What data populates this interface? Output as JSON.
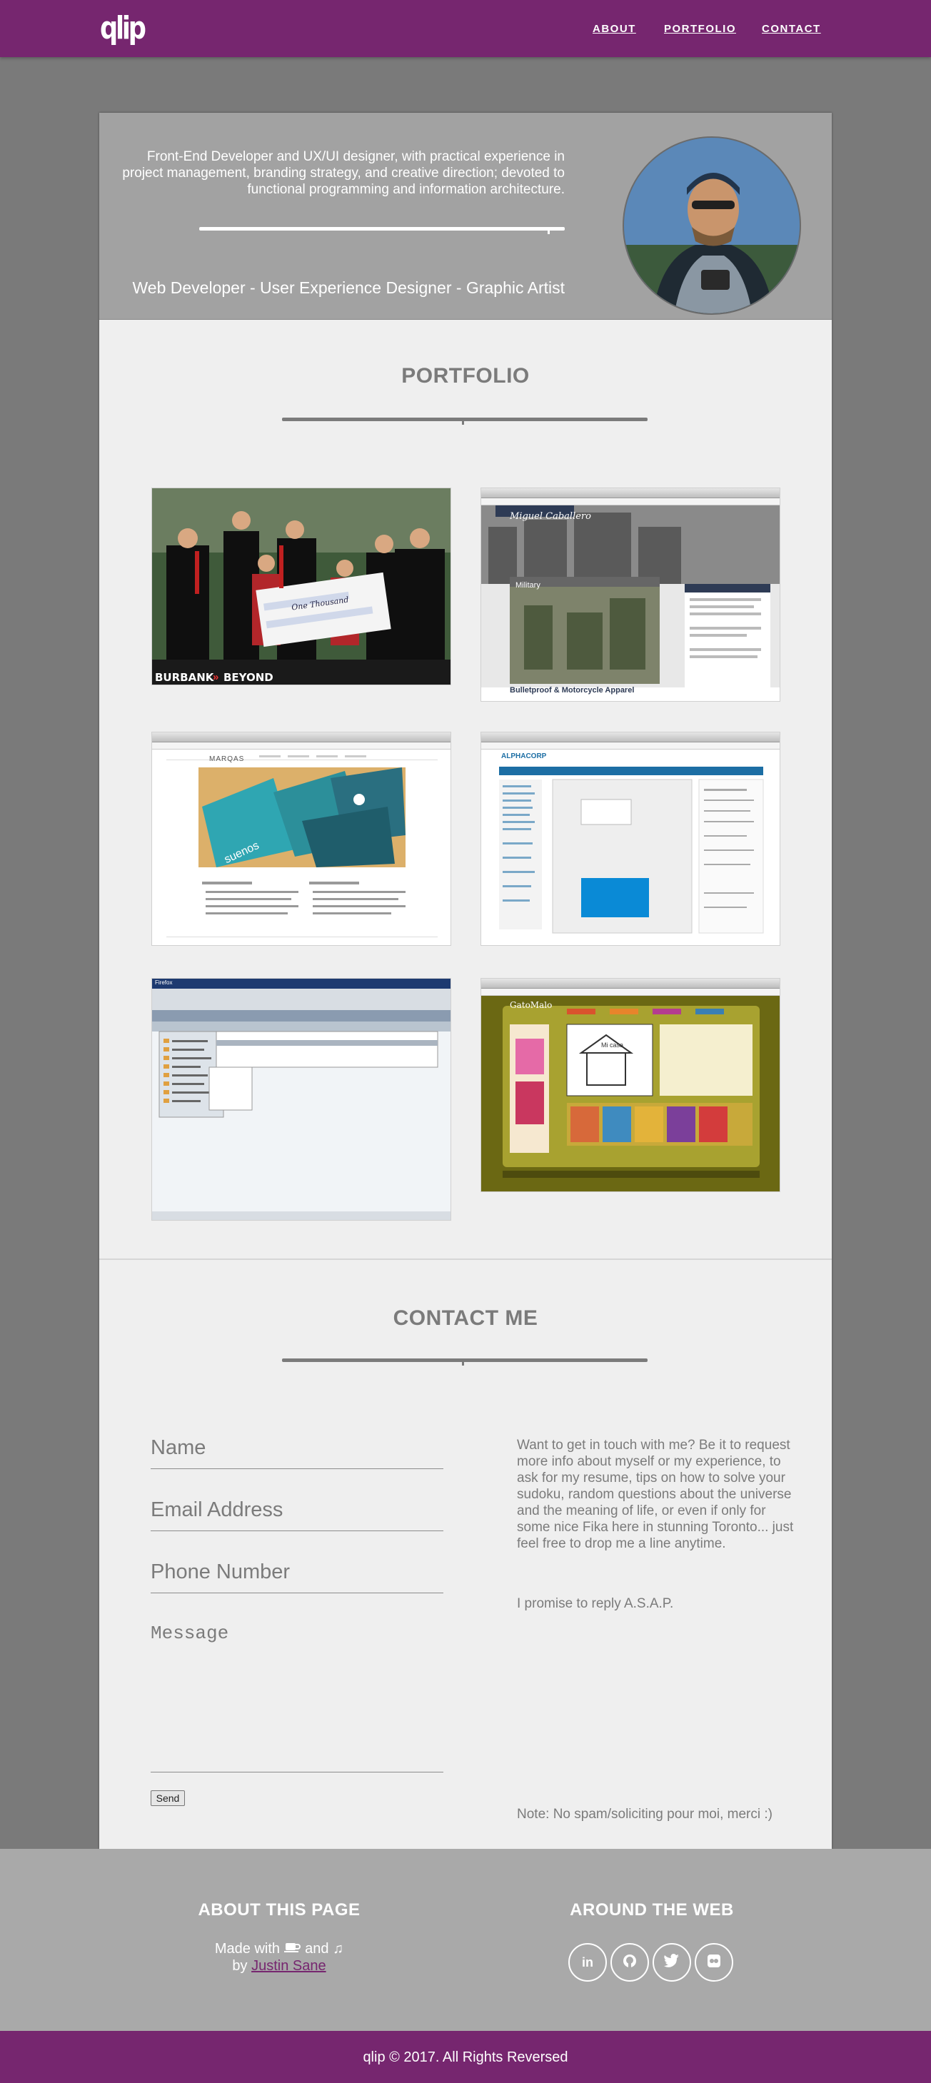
{
  "nav": {
    "logo": "qlip",
    "links": [
      {
        "label": "ABOUT"
      },
      {
        "label": "PORTFOLIO"
      },
      {
        "label": "CONTACT"
      }
    ]
  },
  "hero": {
    "description": "Front-End Developer and UX/UI designer, with practical experience in project management, branding strategy, and creative direction; devoted to functional programming and information architecture.",
    "roles": "Web Developer - User Experience Designer - Graphic Artist"
  },
  "portfolio": {
    "title": "PORTFOLIO",
    "items": [
      {
        "caption": "BURBANK",
        "caption2": "BEYOND",
        "check_text": "One Thousand"
      },
      {
        "caption": "Miguel Caballero",
        "subtitle": "Bulletproof & Motorcycle Apparel",
        "tag": "Military"
      },
      {
        "caption": "MARQAS",
        "tag": "suenos"
      },
      {
        "caption": "ALPHACORP"
      },
      {
        "caption": "Firefox"
      },
      {
        "caption": "GatoMalo",
        "tag": "Mi casa"
      }
    ]
  },
  "contact": {
    "title": "CONTACT ME",
    "name_placeholder": "Name",
    "email_placeholder": "Email Address",
    "phone_placeholder": "Phone Number",
    "message_placeholder": "Message",
    "send_label": "Send",
    "intro": "Want to get in touch with me? Be it to request more info about myself or my experience, to ask for my resume, tips on how to solve your sudoku, random questions about the universe and the meaning of life, or even if only for some nice Fika here in stunning Toronto... just feel free to drop me a line anytime.",
    "promise": "I promise to reply A.S.A.P.",
    "note": "Note: No spam/soliciting pour moi, merci :)"
  },
  "footer": {
    "about_title": "ABOUT THIS PAGE",
    "made_with": "Made with",
    "and": "and",
    "by": "by",
    "author": "Justin Sane",
    "web_title": "AROUND THE WEB",
    "social": [
      {
        "icon": "linkedin-icon",
        "glyph": "in"
      },
      {
        "icon": "github-icon",
        "glyph": ""
      },
      {
        "icon": "twitter-icon",
        "glyph": ""
      },
      {
        "icon": "flickr-icon",
        "glyph": ""
      }
    ],
    "copyright": "qlip © 2017. All Rights Reversed"
  },
  "colors": {
    "brand": "#76266f",
    "page_bg": "#7a7a7a",
    "card_bg": "#efefef",
    "hero_bg": "#a2a2a2",
    "footer_bg": "#a9a9a9"
  }
}
